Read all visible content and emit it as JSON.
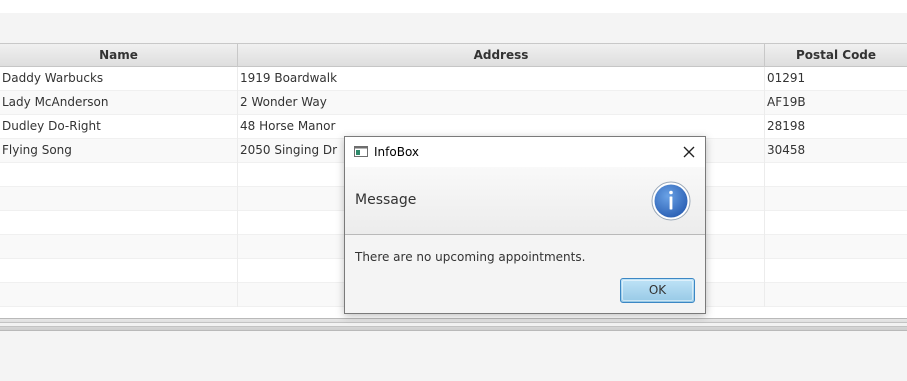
{
  "table": {
    "columns": {
      "name": "Name",
      "address": "Address",
      "postal": "Postal Code"
    },
    "rows": [
      {
        "name": "Daddy Warbucks",
        "address": "1919 Boardwalk",
        "postal": "01291"
      },
      {
        "name": "Lady McAnderson",
        "address": "2 Wonder Way",
        "postal": "AF19B"
      },
      {
        "name": "Dudley Do-Right",
        "address": "48 Horse Manor",
        "postal": "28198"
      },
      {
        "name": "Flying Song",
        "address": "2050 Singing Dr",
        "postal": "30458"
      },
      {
        "name": "",
        "address": "",
        "postal": ""
      },
      {
        "name": "",
        "address": "",
        "postal": ""
      },
      {
        "name": "",
        "address": "",
        "postal": ""
      },
      {
        "name": "",
        "address": "",
        "postal": ""
      },
      {
        "name": "",
        "address": "",
        "postal": ""
      },
      {
        "name": "",
        "address": "",
        "postal": ""
      }
    ]
  },
  "dialog": {
    "title": "InfoBox",
    "header": "Message",
    "content": "There are no upcoming appointments.",
    "ok_label": "OK",
    "icons": {
      "app": "window-app-icon",
      "close": "close-icon",
      "info": "information-icon"
    },
    "colors": {
      "info_icon": "#3b73c7",
      "ok_button": "#a9d5ee",
      "ok_border": "#3c87c4"
    }
  }
}
